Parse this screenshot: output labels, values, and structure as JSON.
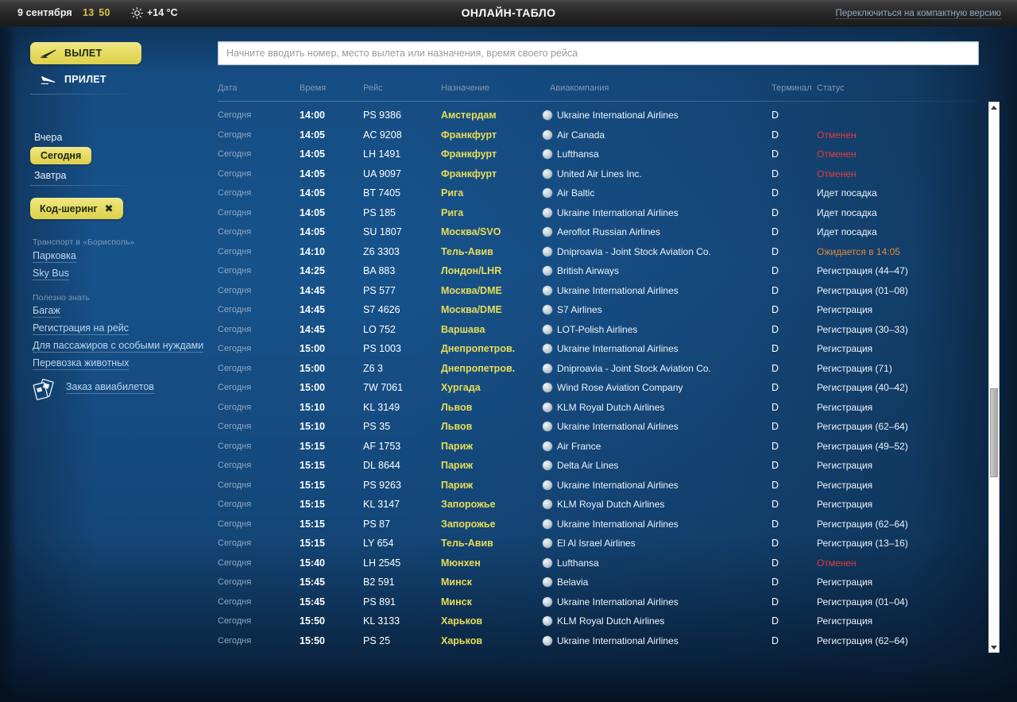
{
  "topbar": {
    "date": "9 сентября",
    "time_hours": "13",
    "time_separator": " ",
    "time_minutes": "50",
    "weather_icon": "sun-icon",
    "temperature": "+14 °C",
    "title": "ОНЛАЙН-ТАБЛО",
    "compact_link": "Переключиться на компактную версию"
  },
  "sidebar": {
    "departures_label": "ВЫЛЕТ",
    "departures_icon": "plane-departure-icon",
    "arrivals_label": "ПРИЛЕТ",
    "arrivals_icon": "plane-arrival-icon",
    "days": [
      {
        "label": "Вчера",
        "active": false
      },
      {
        "label": "Сегодня",
        "active": true
      },
      {
        "label": "Завтра",
        "active": false
      }
    ],
    "codeshare_label": "Код-шеринг",
    "codeshare_close_icon": "close-x-icon",
    "transport_section_title": "Транспорт в «Борисполь»",
    "transport_links": [
      "Парковка",
      "Sky Bus"
    ],
    "useful_section_title": "Полезно знать",
    "useful_links": [
      "Багаж",
      "Регистрация на рейс",
      "Для пассажиров с особыми нуждами",
      "Перевозка животных"
    ],
    "tickets_icon": "tickets-icon",
    "tickets_label": "Заказ авиабилетов"
  },
  "search": {
    "placeholder": "Начните вводить номер, место вылета или назначения, время своего рейса",
    "value": ""
  },
  "table": {
    "columns": {
      "date": "Дата",
      "time": "Время",
      "flight": "Рейс",
      "destination": "Назначение",
      "airline": "Авиакомпания",
      "terminal": "Терминал",
      "status": "Статус"
    },
    "rows": [
      {
        "date": "Сегодня",
        "time": "14:00",
        "flight": "PS 9386",
        "destination": "Амстердам",
        "airline": "Ukraine International Airlines",
        "terminal": "D",
        "status": "",
        "status_type": "normal"
      },
      {
        "date": "Сегодня",
        "time": "14:05",
        "flight": "AC 9208",
        "destination": "Франкфурт",
        "airline": "Air Canada",
        "terminal": "D",
        "status": "Отменен",
        "status_type": "cancelled"
      },
      {
        "date": "Сегодня",
        "time": "14:05",
        "flight": "LH 1491",
        "destination": "Франкфурт",
        "airline": "Lufthansa",
        "terminal": "D",
        "status": "Отменен",
        "status_type": "cancelled"
      },
      {
        "date": "Сегодня",
        "time": "14:05",
        "flight": "UA 9097",
        "destination": "Франкфурт",
        "airline": "United Air Lines Inc.",
        "terminal": "D",
        "status": "Отменен",
        "status_type": "cancelled"
      },
      {
        "date": "Сегодня",
        "time": "14:05",
        "flight": "BT 7405",
        "destination": "Рига",
        "airline": "Air Baltic",
        "terminal": "D",
        "status": "Идет посадка",
        "status_type": "normal"
      },
      {
        "date": "Сегодня",
        "time": "14:05",
        "flight": "PS 185",
        "destination": "Рига",
        "airline": "Ukraine International Airlines",
        "terminal": "D",
        "status": "Идет посадка",
        "status_type": "normal"
      },
      {
        "date": "Сегодня",
        "time": "14:05",
        "flight": "SU 1807",
        "destination": "Москва/SVO",
        "airline": "Aeroflot Russian Airlines",
        "terminal": "D",
        "status": "Идет посадка",
        "status_type": "normal"
      },
      {
        "date": "Сегодня",
        "time": "14:10",
        "flight": "Z6 3303",
        "destination": "Тель-Авив",
        "airline": "Dniproavia - Joint Stock Aviation Co.",
        "terminal": "D",
        "status": "Ожидается в 14:05",
        "status_type": "expected"
      },
      {
        "date": "Сегодня",
        "time": "14:25",
        "flight": "BA 883",
        "destination": "Лондон/LHR",
        "airline": "British Airways",
        "terminal": "D",
        "status": "Регистрация (44–47)",
        "status_type": "normal"
      },
      {
        "date": "Сегодня",
        "time": "14:45",
        "flight": "PS 577",
        "destination": "Москва/DME",
        "airline": "Ukraine International Airlines",
        "terminal": "D",
        "status": "Регистрация (01–08)",
        "status_type": "normal"
      },
      {
        "date": "Сегодня",
        "time": "14:45",
        "flight": "S7 4626",
        "destination": "Москва/DME",
        "airline": "S7 Airlines",
        "terminal": "D",
        "status": "Регистрация",
        "status_type": "normal"
      },
      {
        "date": "Сегодня",
        "time": "14:45",
        "flight": "LO 752",
        "destination": "Варшава",
        "airline": "LOT-Polish Airlines",
        "terminal": "D",
        "status": "Регистрация (30–33)",
        "status_type": "normal"
      },
      {
        "date": "Сегодня",
        "time": "15:00",
        "flight": "PS 1003",
        "destination": "Днепропетров.",
        "airline": "Ukraine International Airlines",
        "terminal": "D",
        "status": "Регистрация",
        "status_type": "normal"
      },
      {
        "date": "Сегодня",
        "time": "15:00",
        "flight": "Z6 3",
        "destination": "Днепропетров.",
        "airline": "Dniproavia - Joint Stock Aviation Co.",
        "terminal": "D",
        "status": "Регистрация (71)",
        "status_type": "normal"
      },
      {
        "date": "Сегодня",
        "time": "15:00",
        "flight": "7W 7061",
        "destination": "Хургада",
        "airline": "Wind Rose Aviation Company",
        "terminal": "D",
        "status": "Регистрация (40–42)",
        "status_type": "normal"
      },
      {
        "date": "Сегодня",
        "time": "15:10",
        "flight": "KL 3149",
        "destination": "Львов",
        "airline": "KLM Royal Dutch Airlines",
        "terminal": "D",
        "status": "Регистрация",
        "status_type": "normal"
      },
      {
        "date": "Сегодня",
        "time": "15:10",
        "flight": "PS 35",
        "destination": "Львов",
        "airline": "Ukraine International Airlines",
        "terminal": "D",
        "status": "Регистрация (62–64)",
        "status_type": "normal"
      },
      {
        "date": "Сегодня",
        "time": "15:15",
        "flight": "AF 1753",
        "destination": "Париж",
        "airline": "Air France",
        "terminal": "D",
        "status": "Регистрация (49–52)",
        "status_type": "normal"
      },
      {
        "date": "Сегодня",
        "time": "15:15",
        "flight": "DL 8644",
        "destination": "Париж",
        "airline": "Delta Air Lines",
        "terminal": "D",
        "status": "Регистрация",
        "status_type": "normal"
      },
      {
        "date": "Сегодня",
        "time": "15:15",
        "flight": "PS 9263",
        "destination": "Париж",
        "airline": "Ukraine International Airlines",
        "terminal": "D",
        "status": "Регистрация",
        "status_type": "normal"
      },
      {
        "date": "Сегодня",
        "time": "15:15",
        "flight": "KL 3147",
        "destination": "Запорожье",
        "airline": "KLM Royal Dutch Airlines",
        "terminal": "D",
        "status": "Регистрация",
        "status_type": "normal"
      },
      {
        "date": "Сегодня",
        "time": "15:15",
        "flight": "PS 87",
        "destination": "Запорожье",
        "airline": "Ukraine International Airlines",
        "terminal": "D",
        "status": "Регистрация (62–64)",
        "status_type": "normal"
      },
      {
        "date": "Сегодня",
        "time": "15:15",
        "flight": "LY 654",
        "destination": "Тель-Авив",
        "airline": "El Al Israel Airlines",
        "terminal": "D",
        "status": "Регистрация (13–16)",
        "status_type": "normal"
      },
      {
        "date": "Сегодня",
        "time": "15:40",
        "flight": "LH 2545",
        "destination": "Мюнхен",
        "airline": "Lufthansa",
        "terminal": "D",
        "status": "Отменен",
        "status_type": "cancelled"
      },
      {
        "date": "Сегодня",
        "time": "15:45",
        "flight": "B2 591",
        "destination": "Минск",
        "airline": "Belavia",
        "terminal": "D",
        "status": "Регистрация",
        "status_type": "normal"
      },
      {
        "date": "Сегодня",
        "time": "15:45",
        "flight": "PS 891",
        "destination": "Минск",
        "airline": "Ukraine International Airlines",
        "terminal": "D",
        "status": "Регистрация (01–04)",
        "status_type": "normal"
      },
      {
        "date": "Сегодня",
        "time": "15:50",
        "flight": "KL 3133",
        "destination": "Харьков",
        "airline": "KLM Royal Dutch Airlines",
        "terminal": "D",
        "status": "Регистрация",
        "status_type": "normal"
      },
      {
        "date": "Сегодня",
        "time": "15:50",
        "flight": "PS 25",
        "destination": "Харьков",
        "airline": "Ukraine International Airlines",
        "terminal": "D",
        "status": "Регистрация (62–64)",
        "status_type": "normal"
      }
    ]
  },
  "scrollbar": {
    "up_icon": "scroll-up-arrow-icon",
    "down_icon": "scroll-down-arrow-icon"
  },
  "colors": {
    "accent_yellow": "#e7dc62",
    "destination_yellow": "#e8dd56",
    "cancelled_red": "#e23c3c",
    "expected_orange": "#e2873a",
    "panel_blue": "#17528b",
    "header_text": "#7d9ab8"
  }
}
